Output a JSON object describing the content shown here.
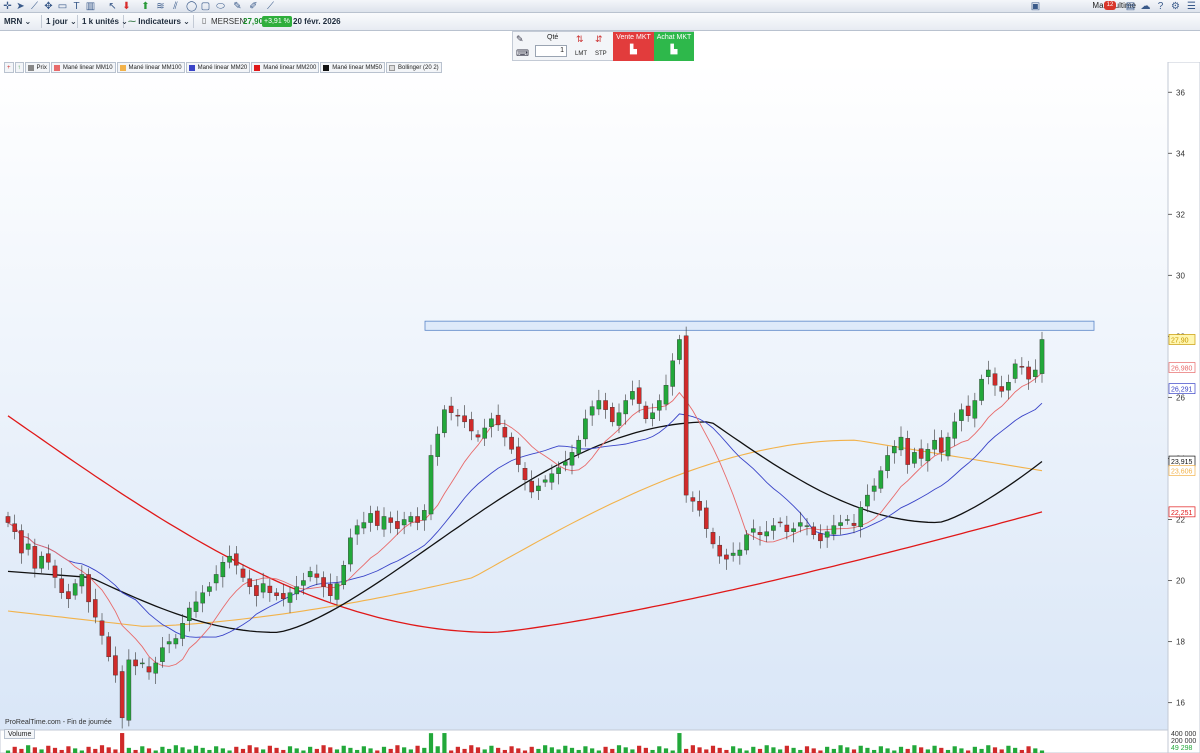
{
  "toolbar": {
    "platform": "Mané ultime",
    "notifications": "12"
  },
  "symbol_bar": {
    "ticker": "MRN",
    "period": "1 jour",
    "units": "1 k unités",
    "indicators": "Indicateurs",
    "name": "MERSEN",
    "price": "27,90",
    "change": "+3,91 %",
    "date": "20 févr. 2026"
  },
  "order_panel": {
    "qty_label": "Qté",
    "qty_value": "1",
    "lmt": "LMT",
    "stp": "STP",
    "sell": "Vente MKT",
    "buy": "Achat MKT"
  },
  "legend": [
    {
      "label": "Prix",
      "color": "#888888"
    },
    {
      "label": "Mané linear MM10",
      "color": "#e86a6a"
    },
    {
      "label": "Mané linear MM100",
      "color": "#f2b24a"
    },
    {
      "label": "Mané linear MM20",
      "color": "#3a44c8"
    },
    {
      "label": "Mané linear MM200",
      "color": "#e01818"
    },
    {
      "label": "Mané linear MM50",
      "color": "#111111"
    },
    {
      "label": "Bollinger (20 2)",
      "color": "#dddddd"
    }
  ],
  "footer": {
    "credit": "ProRealTime.com - Fin de journée",
    "volume_label": "Volume"
  },
  "chart_data": {
    "type": "candlestick",
    "ylim": [
      15.2,
      36.6
    ],
    "yticks": [
      16,
      18,
      20,
      22,
      24,
      26,
      28,
      30,
      32,
      34,
      36
    ],
    "bars": 150,
    "ohlc_close": [
      21.9,
      21.6,
      20.9,
      21.2,
      20.4,
      20.8,
      20.6,
      20.1,
      19.6,
      19.4,
      19.9,
      20.2,
      19.3,
      18.8,
      18.2,
      17.5,
      16.9,
      15.5,
      17.4,
      17.2,
      17.3,
      17.0,
      17.3,
      17.8,
      18.0,
      18.1,
      18.6,
      19.1,
      19.3,
      19.6,
      19.8,
      20.2,
      20.6,
      20.8,
      20.5,
      20.1,
      19.8,
      19.5,
      19.9,
      19.6,
      19.5,
      19.4,
      19.6,
      19.8,
      20.0,
      20.3,
      20.1,
      19.8,
      19.5,
      19.9,
      20.5,
      21.4,
      21.8,
      21.9,
      22.2,
      21.8,
      22.1,
      21.9,
      21.7,
      22.0,
      22.1,
      21.9,
      22.3,
      24.1,
      24.8,
      25.6,
      25.5,
      25.4,
      25.2,
      24.9,
      24.7,
      25.0,
      25.3,
      25.1,
      24.7,
      24.3,
      23.8,
      23.3,
      22.9,
      23.1,
      23.3,
      23.5,
      23.7,
      23.9,
      24.2,
      24.6,
      25.3,
      25.7,
      25.9,
      25.6,
      25.2,
      25.5,
      25.9,
      26.2,
      25.8,
      25.3,
      25.5,
      25.9,
      26.4,
      27.2,
      27.9,
      22.8,
      22.6,
      22.3,
      21.7,
      21.2,
      20.8,
      20.7,
      20.9,
      21.0,
      21.5,
      21.7,
      21.5,
      21.6,
      21.8,
      21.9,
      21.6,
      21.7,
      21.9,
      21.8,
      21.5,
      21.3,
      21.6,
      21.8,
      21.9,
      22.0,
      21.8,
      22.4,
      22.8,
      23.1,
      23.6,
      24.1,
      24.4,
      24.7,
      23.8,
      24.2,
      24.0,
      24.3,
      24.6,
      24.2,
      24.7,
      25.2,
      25.6,
      25.4,
      25.9,
      26.6,
      26.9,
      26.4,
      26.2,
      26.5,
      27.1,
      27.0,
      26.6,
      26.9
    ],
    "last_close": 27.9,
    "resistance_zone": [
      28.2,
      28.5
    ],
    "series": [
      {
        "name": "MM10",
        "color": "#e86a6a"
      },
      {
        "name": "MM20",
        "color": "#3a44c8"
      },
      {
        "name": "MM50",
        "color": "#111111"
      },
      {
        "name": "MM100",
        "color": "#f2b24a"
      },
      {
        "name": "MM200",
        "color": "#e01818"
      }
    ],
    "axis_labels": [
      {
        "text": "27,90",
        "value": 27.9,
        "color": "#c89a00",
        "bg": "#fff6b0"
      },
      {
        "text": "26,980",
        "value": 26.98,
        "color": "#e86a6a",
        "bg": "#ffffff"
      },
      {
        "text": "26,291",
        "value": 26.29,
        "color": "#3a44c8",
        "bg": "#ffffff"
      },
      {
        "text": "23,915",
        "value": 23.915,
        "color": "#111111",
        "bg": "#ffffff"
      },
      {
        "text": "23,606",
        "value": 23.606,
        "color": "#f2b24a",
        "bg": "#ffffff"
      },
      {
        "text": "22,251",
        "value": 22.251,
        "color": "#e01818",
        "bg": "#ffffff"
      }
    ],
    "volume_ticks": [
      "400 000",
      "200 000",
      "49 298"
    ]
  }
}
